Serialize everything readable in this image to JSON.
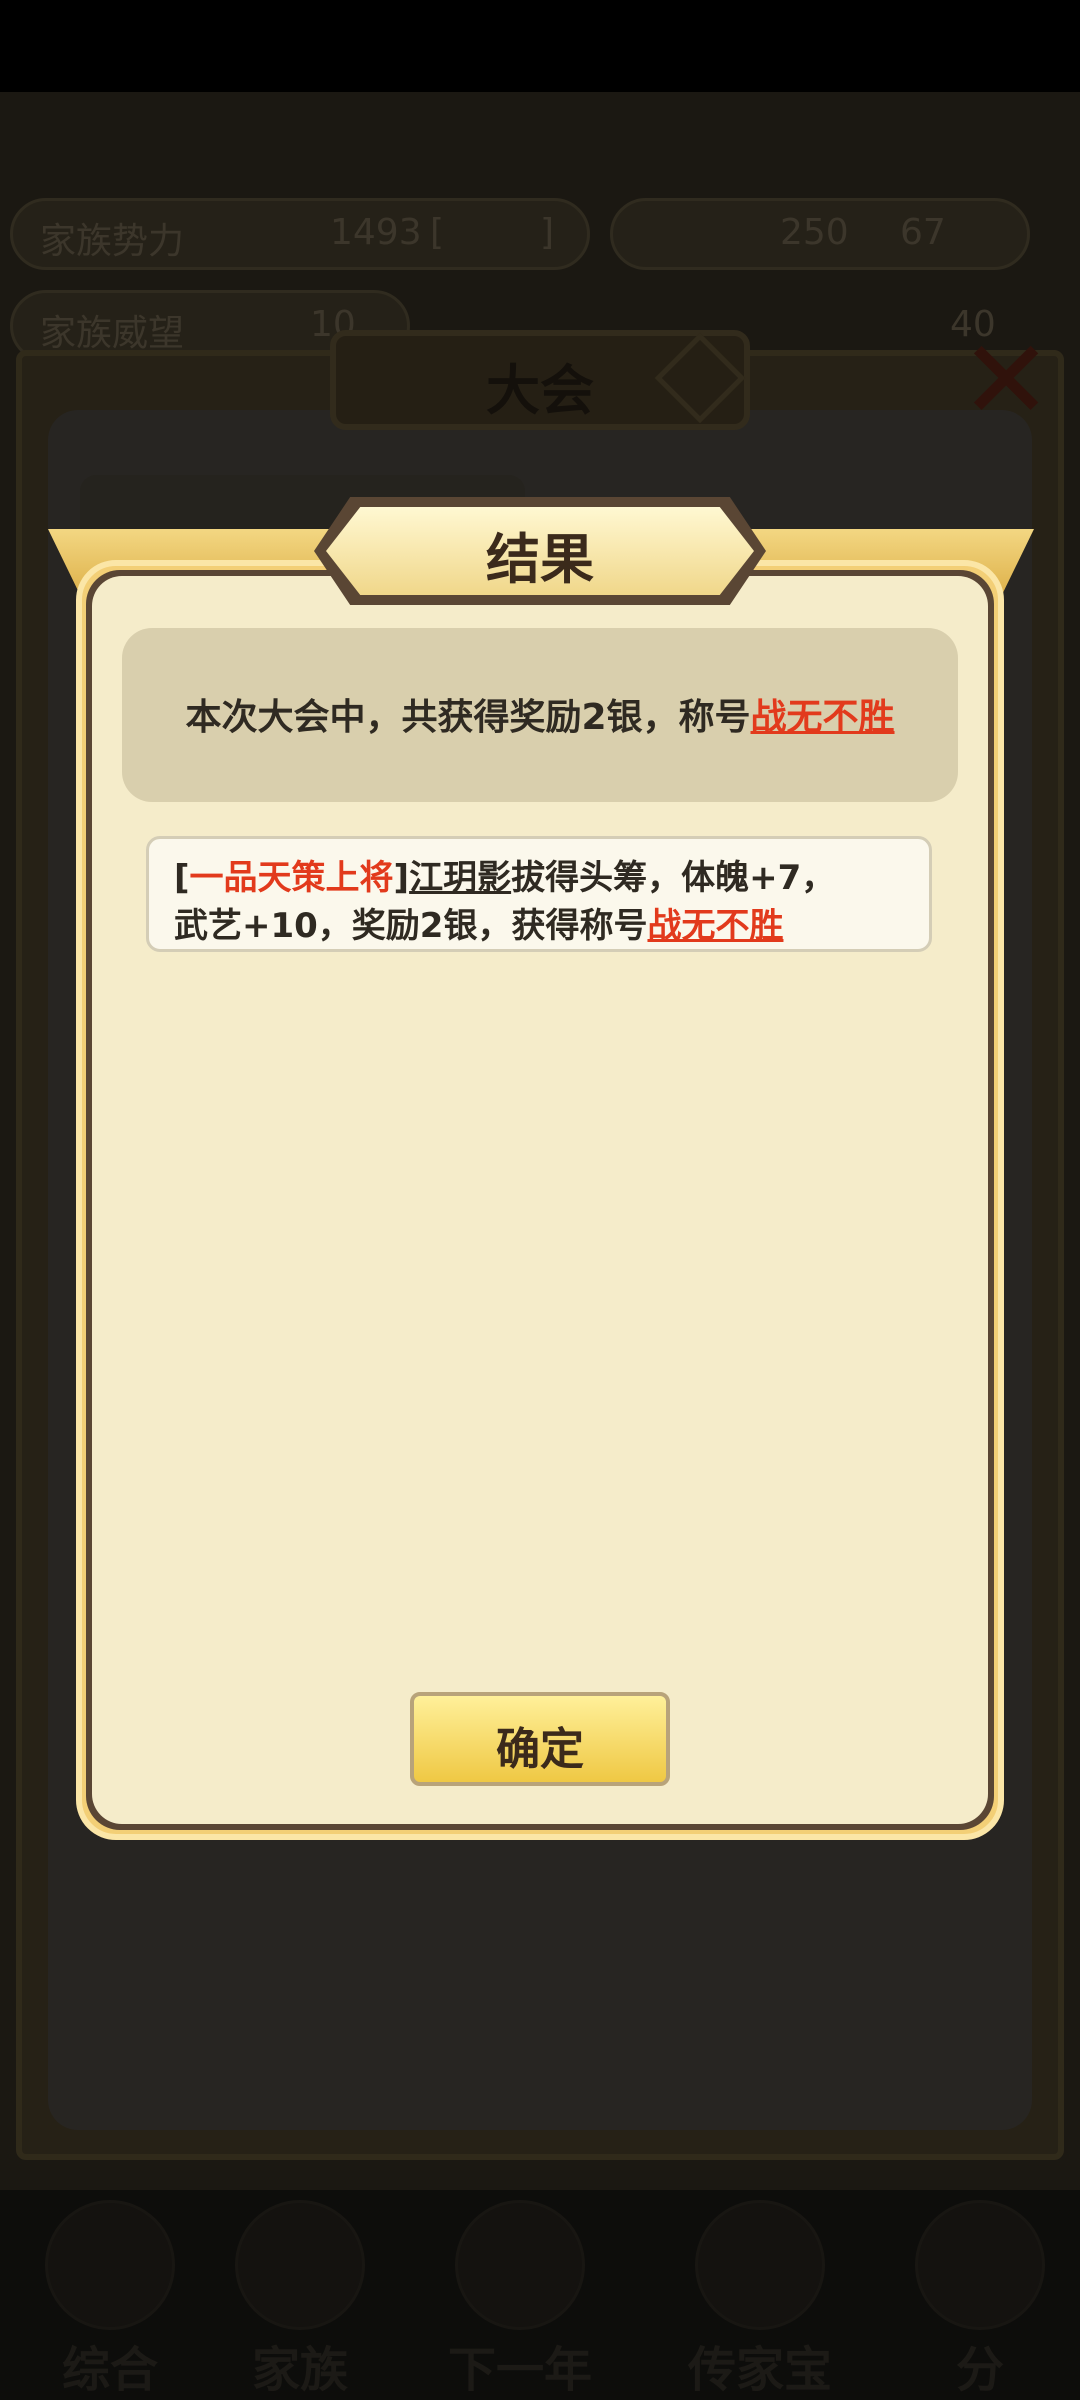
{
  "background": {
    "stats_row1": {
      "label": "家族势力",
      "value": "1493",
      "bracket_open": "[",
      "bracket_close": "]",
      "resource1": "250",
      "resource2": "67"
    },
    "stats_row2": {
      "label": "家族威望",
      "value": "10",
      "value2": "40"
    },
    "panel_title": "大会",
    "nav": [
      {
        "label": "综合"
      },
      {
        "label": "家族"
      },
      {
        "label": "下一年"
      },
      {
        "label": "传家宝"
      },
      {
        "label": "分"
      }
    ]
  },
  "dialog": {
    "title": "结果",
    "summary_prefix": "本次大会中，共获得奖励2银，称号",
    "summary_title": "战无不胜",
    "detail": {
      "bracket_open": "[",
      "rank": "一品天策上将",
      "bracket_close": "]",
      "name": "江玥影",
      "line1_rest": "拔得头筹，体魄+7，",
      "line2_prefix": "武艺+10，奖励2银，获得称号",
      "title": "战无不胜"
    },
    "confirm_label": "确定"
  },
  "colors": {
    "accent_red": "#e23a1c",
    "dialog_bg": "#f5ecca",
    "frame_gold": "#f3cf76"
  }
}
